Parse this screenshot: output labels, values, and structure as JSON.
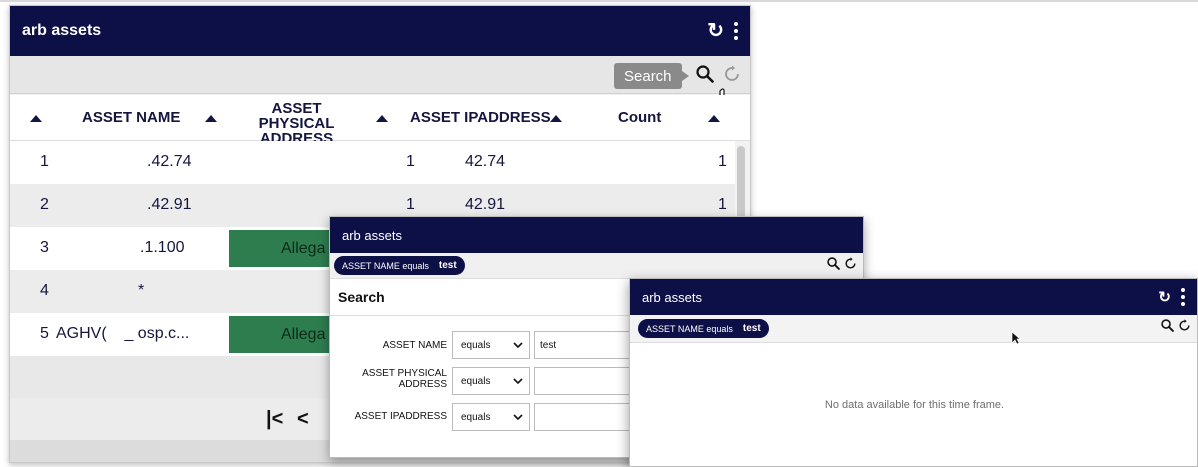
{
  "panel1": {
    "title": "arb assets",
    "tooltip": "Search",
    "columns": [
      "ASSET NAME",
      "ASSET PHYSICAL ADDRESS",
      "ASSET IPADDRESS",
      "Count"
    ],
    "rows": [
      {
        "num": "1",
        "name": ".42.74",
        "alleg": "",
        "ip_prefix": "1",
        "ip": "42.74",
        "count": "1"
      },
      {
        "num": "2",
        "name": ".42.91",
        "alleg": "",
        "ip_prefix": "1",
        "ip": "42.91",
        "count": "1"
      },
      {
        "num": "3",
        "name": ".1.100",
        "alleg": "Allega",
        "ip_prefix": "",
        "ip": "",
        "count": ""
      },
      {
        "num": "4",
        "name": "*",
        "alleg": "",
        "ip_prefix": "",
        "ip": "",
        "count": ""
      },
      {
        "num": "5",
        "name": "AGHV(    _ osp.c...",
        "alleg": "Allega",
        "ip_prefix": "",
        "ip": "",
        "count": ""
      }
    ],
    "pager": {
      "first": "|<",
      "prev": "<"
    }
  },
  "panel2": {
    "title": "arb assets",
    "chip_label": "ASSET NAME equals",
    "chip_value": "test",
    "heading": "Search",
    "fields": [
      {
        "label": "ASSET NAME",
        "operator": "equals",
        "value": "test"
      },
      {
        "label": "ASSET PHYSICAL ADDRESS",
        "operator": "equals",
        "value": ""
      },
      {
        "label": "ASSET IPADDRESS",
        "operator": "equals",
        "value": ""
      }
    ]
  },
  "panel3": {
    "title": "arb assets",
    "chip_label": "ASSET NAME equals",
    "chip_value": "test",
    "empty_message": "No data available for this time frame."
  },
  "colors": {
    "titlebar": "#0d0f47",
    "highlight_cell": "#2e7d4f",
    "tooltip": "#8a8a8a"
  },
  "icons": [
    "refresh-icon",
    "kebab-menu-icon",
    "search-icon",
    "reset-icon",
    "hand-cursor-icon",
    "pointer-cursor-icon",
    "sort-up-icon",
    "dropdown-caret-icon"
  ]
}
